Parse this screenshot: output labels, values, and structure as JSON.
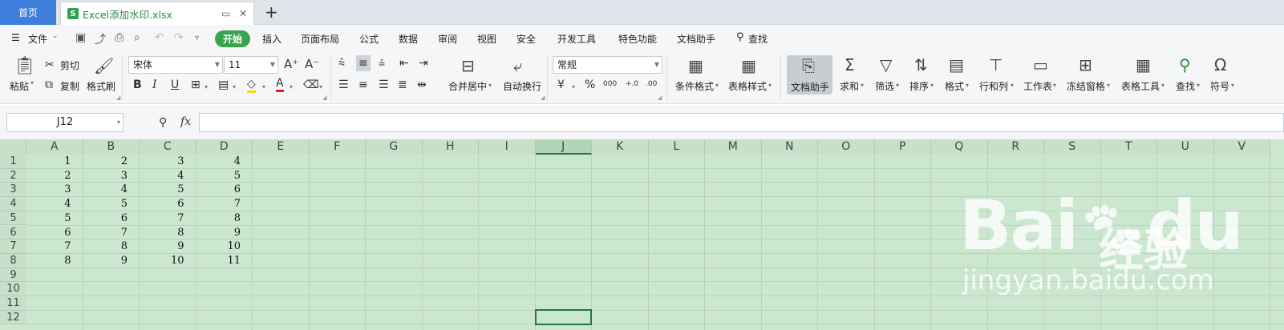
{
  "tabs": {
    "home": "首页",
    "file_name": "Excel添加水印.xlsx",
    "new_tab": "+"
  },
  "menu": {
    "file": "文件",
    "items": [
      "开始",
      "插入",
      "页面布局",
      "公式",
      "数据",
      "审阅",
      "视图",
      "安全",
      "开发工具",
      "特色功能",
      "文档助手"
    ],
    "search": "查找"
  },
  "ribbon": {
    "paste": "粘贴",
    "cut": "剪切",
    "copy": "复制",
    "format_painter": "格式刷",
    "font_name": "宋体",
    "font_size": "11",
    "merge_center": "合并居中",
    "wrap_text": "自动换行",
    "number_format": "常规",
    "cond_format": "条件格式",
    "table_style": "表格样式",
    "doc_helper": "文档助手",
    "sum": "求和",
    "filter": "筛选",
    "sort": "排序",
    "format": "格式",
    "row_col": "行和列",
    "worksheet": "工作表",
    "freeze": "冻结窗格",
    "table_tools": "表格工具",
    "find": "查找",
    "symbol": "符号",
    "thousands": "000",
    "inc_decimal": "+.0",
    "dec_decimal": ".00"
  },
  "formula_bar": {
    "name_box": "J12",
    "fx": "fx",
    "formula": ""
  },
  "sheet": {
    "columns": [
      "A",
      "B",
      "C",
      "D",
      "E",
      "F",
      "G",
      "H",
      "I",
      "J",
      "K",
      "L",
      "M",
      "N",
      "O",
      "P",
      "Q",
      "R",
      "S",
      "T",
      "U",
      "V"
    ],
    "rows": [
      "1",
      "2",
      "3",
      "4",
      "5",
      "6",
      "7",
      "8",
      "9",
      "10",
      "11",
      "12"
    ],
    "data": [
      [
        "1",
        "2",
        "3",
        "4"
      ],
      [
        "2",
        "3",
        "4",
        "5"
      ],
      [
        "3",
        "4",
        "5",
        "6"
      ],
      [
        "4",
        "5",
        "6",
        "7"
      ],
      [
        "5",
        "6",
        "7",
        "8"
      ],
      [
        "6",
        "7",
        "8",
        "9"
      ],
      [
        "7",
        "8",
        "9",
        "10"
      ],
      [
        "8",
        "9",
        "10",
        "11"
      ]
    ],
    "selected_cell": "J12",
    "background_color": "#cce7d0"
  },
  "watermark": {
    "logo_text": "Bai",
    "logo_text2": "du",
    "cn_text": "经验",
    "url_text": "jingyan.baidu.com"
  }
}
